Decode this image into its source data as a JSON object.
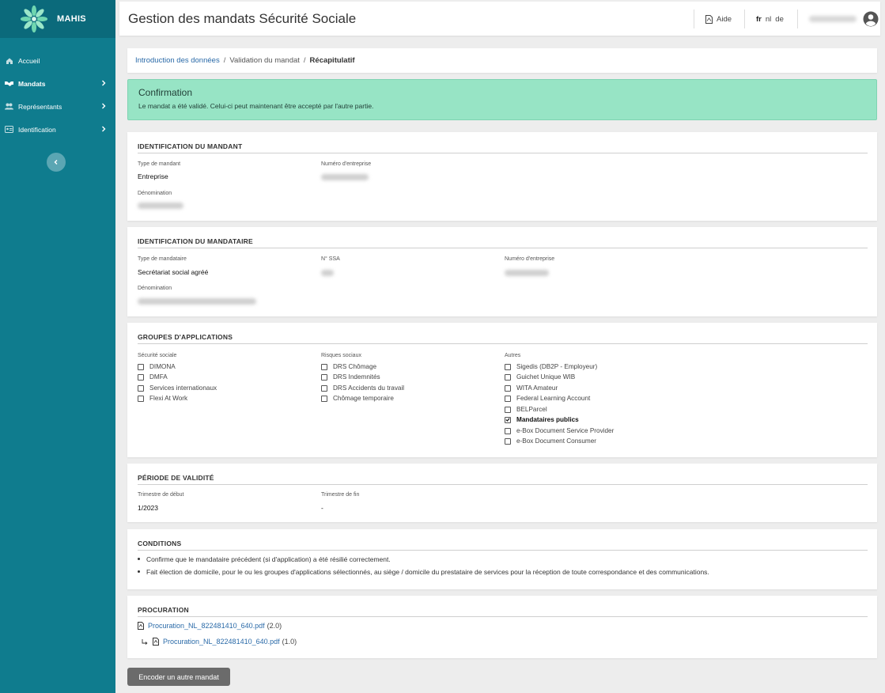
{
  "brand": {
    "name": "MAHIS"
  },
  "sidebar": {
    "items": [
      {
        "label": "Accueil",
        "icon": "home-icon",
        "active": false
      },
      {
        "label": "Mandats",
        "icon": "handshake-icon",
        "active": true
      },
      {
        "label": "Représentants",
        "icon": "users-icon",
        "active": false
      },
      {
        "label": "Identification",
        "icon": "id-card-icon",
        "active": false
      }
    ]
  },
  "header": {
    "title": "Gestion des mandats Sécurité Sociale",
    "help_label": "Aide",
    "languages": [
      "fr",
      "nl",
      "de"
    ],
    "current_language": "fr"
  },
  "breadcrumb": {
    "step1": "Introduction des données",
    "step2": "Validation du mandat",
    "current": "Récapitulatif"
  },
  "alert": {
    "title": "Confirmation",
    "message": "Le mandat a été validé. Celui-ci peut maintenant être accepté par l'autre partie."
  },
  "mandant": {
    "title": "IDENTIFICATION DU MANDANT",
    "type_label": "Type de mandant",
    "type_value": "Entreprise",
    "company_number_label": "Numéro d'entreprise",
    "denomination_label": "Dénomination"
  },
  "mandataire": {
    "title": "IDENTIFICATION DU MANDATAIRE",
    "type_label": "Type de mandataire",
    "type_value": "Secrétariat social agréé",
    "ssa_label": "N° SSA",
    "company_number_label": "Numéro d'entreprise",
    "denomination_label": "Dénomination"
  },
  "groups": {
    "title": "GROUPES D'APPLICATIONS",
    "col1": {
      "label": "Sécurité sociale",
      "items": [
        {
          "label": "DIMONA",
          "checked": false
        },
        {
          "label": "DMFA",
          "checked": false
        },
        {
          "label": "Services internationaux",
          "checked": false
        },
        {
          "label": "Flexi At Work",
          "checked": false
        }
      ]
    },
    "col2": {
      "label": "Risques sociaux",
      "items": [
        {
          "label": "DRS Chômage",
          "checked": false
        },
        {
          "label": "DRS Indemnités",
          "checked": false
        },
        {
          "label": "DRS Accidents du travail",
          "checked": false
        },
        {
          "label": "Chômage temporaire",
          "checked": false
        }
      ]
    },
    "col3": {
      "label": "Autres",
      "items": [
        {
          "label": "Sigedis (DB2P - Employeur)",
          "checked": false
        },
        {
          "label": "Guichet Unique WIB",
          "checked": false
        },
        {
          "label": "WITA Amateur",
          "checked": false
        },
        {
          "label": "Federal Learning Account",
          "checked": false
        },
        {
          "label": "BELParcel",
          "checked": false
        },
        {
          "label": "Mandataires publics",
          "checked": true
        },
        {
          "label": "e-Box Document Service Provider",
          "checked": false
        },
        {
          "label": "e-Box Document Consumer",
          "checked": false
        }
      ]
    }
  },
  "validity": {
    "title": "PÉRIODE DE VALIDITÉ",
    "start_label": "Trimestre de début",
    "start_value": "1/2023",
    "end_label": "Trimestre de fin",
    "end_value": "-"
  },
  "conditions": {
    "title": "CONDITIONS",
    "items": [
      "Confirme que le mandataire précédent (si d'application) a été résilié correctement.",
      "Fait élection de domicile, pour le ou les groupes d'applications sélectionnés, au siège / domicile du prestataire de services pour la réception de toute correspondance et des communications."
    ]
  },
  "procuration": {
    "title": "PROCURATION",
    "files": [
      {
        "name": "Procuration_NL_822481410_640.pdf",
        "version": "(2.0)"
      },
      {
        "name": "Procuration_NL_822481410_640.pdf",
        "version": "(1.0)"
      }
    ]
  },
  "actions": {
    "encode_another": "Encoder un autre mandat"
  },
  "colors": {
    "sidebar": "#0f7c8e",
    "alert": "#97e4c5",
    "link": "#2a6aa8"
  }
}
